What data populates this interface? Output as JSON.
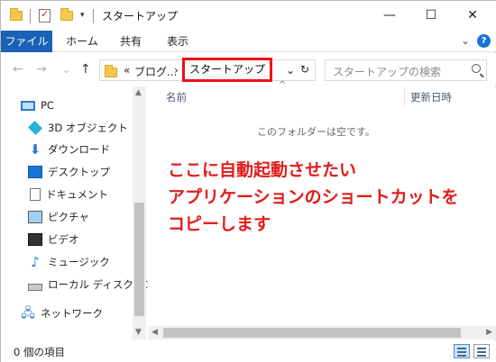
{
  "window": {
    "title": "スタートアップ",
    "minimize_glyph": "—",
    "maximize_glyph": "☐",
    "close_glyph": "✕"
  },
  "ribbon": {
    "tabs": [
      "ファイル",
      "ホーム",
      "共有",
      "表示"
    ],
    "expand_glyph": "⌄",
    "help_glyph": "?"
  },
  "address": {
    "back_glyph": "←",
    "forward_glyph": "→",
    "recent_glyph": "⌄",
    "up_glyph": "↑",
    "overflow": "«",
    "crumb_parent": "ブログ...",
    "crumb_separator": "›",
    "crumb_current": "スタートアップ",
    "dropdown_glyph": "⌄",
    "refresh_glyph": "↻"
  },
  "search": {
    "placeholder": "スタートアップの検索"
  },
  "nav_pane": {
    "items": [
      {
        "label": "PC",
        "icon": "pc-icon"
      },
      {
        "label": "3D オブジェクト",
        "icon": "3d-objects-icon"
      },
      {
        "label": "ダウンロード",
        "icon": "download-icon"
      },
      {
        "label": "デスクトップ",
        "icon": "desktop-icon"
      },
      {
        "label": "ドキュメント",
        "icon": "documents-icon"
      },
      {
        "label": "ピクチャ",
        "icon": "pictures-icon"
      },
      {
        "label": "ビデオ",
        "icon": "videos-icon"
      },
      {
        "label": "ミュージック",
        "icon": "music-icon"
      },
      {
        "label": "ローカル ディスク (C",
        "icon": "local-disk-icon"
      },
      {
        "label": "ネットワーク",
        "icon": "network-icon"
      }
    ]
  },
  "content": {
    "sort_glyph": "^",
    "columns": {
      "name": "名前",
      "date": "更新日時"
    },
    "empty_message": "このフォルダーは空です。",
    "annotation_lines": [
      "ここに自動起動させたい",
      "アプリケーションのショートカットを",
      "コピーします"
    ]
  },
  "status": {
    "item_count": "0 個の項目"
  },
  "colors": {
    "file_tab": "#1a62b6",
    "highlight_box": "#ee1111",
    "annotation_text": "#e31b1b"
  }
}
